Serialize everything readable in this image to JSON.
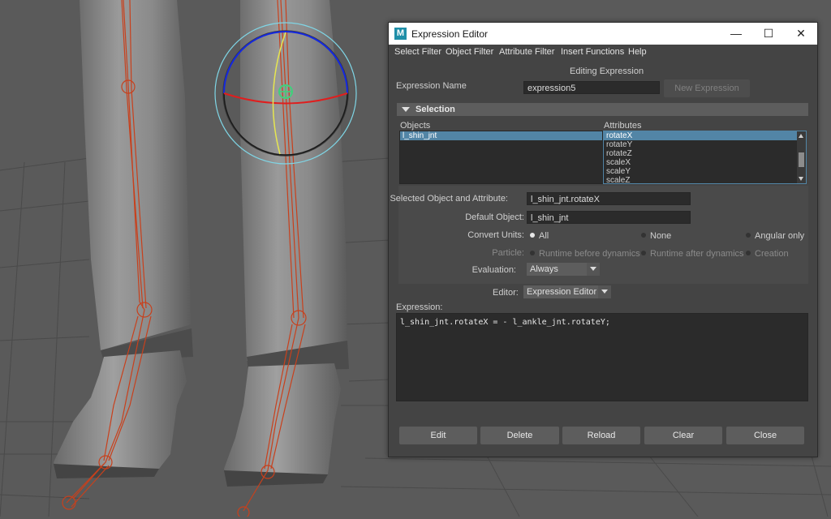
{
  "window": {
    "title": "Expression Editor",
    "logo": "M",
    "minimize_glyph": "—",
    "maximize_glyph": "☐",
    "close_glyph": "✕"
  },
  "menu": [
    "Select Filter",
    "Object Filter",
    "Attribute Filter",
    "Insert Functions",
    "Help"
  ],
  "heading": "Editing Expression",
  "expression_name": {
    "label": "Expression Name",
    "value": "expression5",
    "new_button": "New Expression"
  },
  "selection": {
    "title": "Selection",
    "objects_label": "Objects",
    "objects": [
      "l_shin_jnt"
    ],
    "attributes_label": "Attributes",
    "attributes": [
      "rotateX",
      "rotateY",
      "rotateZ",
      "scaleX",
      "scaleY",
      "scaleZ"
    ]
  },
  "selected_attr": {
    "label": "Selected Object and Attribute:",
    "value": "l_shin_jnt.rotateX"
  },
  "default_object": {
    "label": "Default Object:",
    "value": "l_shin_jnt"
  },
  "convert_units": {
    "label": "Convert Units:",
    "options": [
      "All",
      "None",
      "Angular only"
    ],
    "selected": "All"
  },
  "particle": {
    "label": "Particle:",
    "options": [
      "Runtime before dynamics",
      "Runtime after dynamics",
      "Creation"
    ]
  },
  "evaluation": {
    "label": "Evaluation:",
    "value": "Always"
  },
  "editor": {
    "label": "Editor:",
    "value": "Expression Editor"
  },
  "expression": {
    "label": "Expression:",
    "text": "l_shin_jnt.rotateX = - l_ankle_jnt.rotateY;"
  },
  "buttons": {
    "edit": "Edit",
    "delete": "Delete",
    "reload": "Reload",
    "clear": "Clear",
    "close": "Close"
  },
  "colors": {
    "rig": "#c8401c",
    "panel": "#444444",
    "selection": "#5285a6",
    "manip_blue": "#1428e0",
    "manip_red": "#e01e1e",
    "manip_yellow": "#e6e650",
    "manip_cyan": "#7fd6e6",
    "manip_green": "#3fd17a"
  }
}
